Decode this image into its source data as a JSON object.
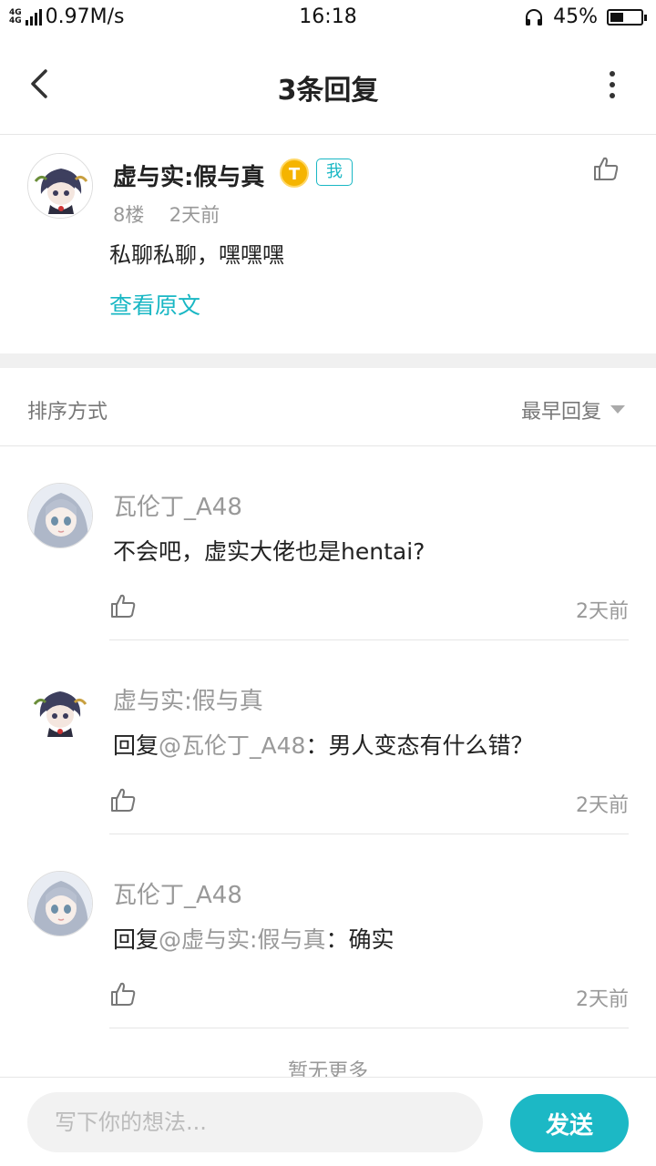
{
  "status_bar": {
    "network_tags": [
      "4G",
      "4G"
    ],
    "speed": "0.97M/s",
    "time": "16:18",
    "battery": "45%",
    "battery_level": 0.45
  },
  "header": {
    "title": "3条回复",
    "back_icon": "chevron-left-icon",
    "more_icon": "more-vertical-icon"
  },
  "post": {
    "author": "虚与实:假与真",
    "level_badge": "T",
    "me_badge": "我",
    "floor": "8楼",
    "time": "2天前",
    "text": "私聊私聊，嘿嘿嘿",
    "view_original": "查看原文",
    "like_icon": "thumbs-up-icon"
  },
  "sort": {
    "label": "排序方式",
    "value": "最早回复"
  },
  "replies": [
    {
      "author": "瓦伦丁_A48",
      "prefix": "",
      "mention": "",
      "text": "不会吧，虚实大佬也是hentai?",
      "time": "2天前",
      "avatar": "anime-girl-avatar"
    },
    {
      "author": "虚与实:假与真",
      "prefix": "回复",
      "mention": "@瓦伦丁_A48",
      "text": "：男人变态有什么错？",
      "time": "2天前",
      "avatar": "anime-dark-hair-avatar"
    },
    {
      "author": "瓦伦丁_A48",
      "prefix": "回复",
      "mention": "@虚与实:假与真",
      "text": "：确实",
      "time": "2天前",
      "avatar": "anime-girl-avatar"
    }
  ],
  "footer_hint": "暂无更多",
  "input": {
    "placeholder": "写下你的想法...",
    "value": "",
    "send_label": "发送"
  },
  "colors": {
    "accent": "#19b7c4",
    "muted_text": "#999999",
    "divider": "#f0f0f0"
  }
}
